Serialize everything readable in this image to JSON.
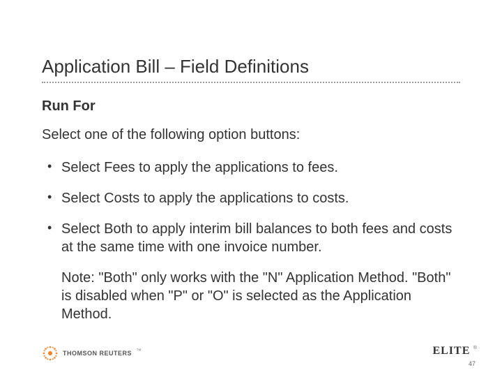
{
  "title": "Application Bill – Field Definitions",
  "subheading": "Run For",
  "lead": "Select one of the following option buttons:",
  "bullets": [
    "Select Fees to apply the applications to fees.",
    "Select Costs to apply the applications to costs.",
    "Select Both to apply interim bill balances to both fees and costs at the same time with one invoice number."
  ],
  "note": "Note: \"Both\" only works with the \"N\" Application Method. \"Both\" is disabled when \"P\" or \"O\" is selected as the Application Method.",
  "footer": {
    "brand_left": "THOMSON REUTERS",
    "brand_right": "ELITE",
    "page_number": "47"
  },
  "colors": {
    "accent": "#f58220",
    "text": "#333333"
  }
}
